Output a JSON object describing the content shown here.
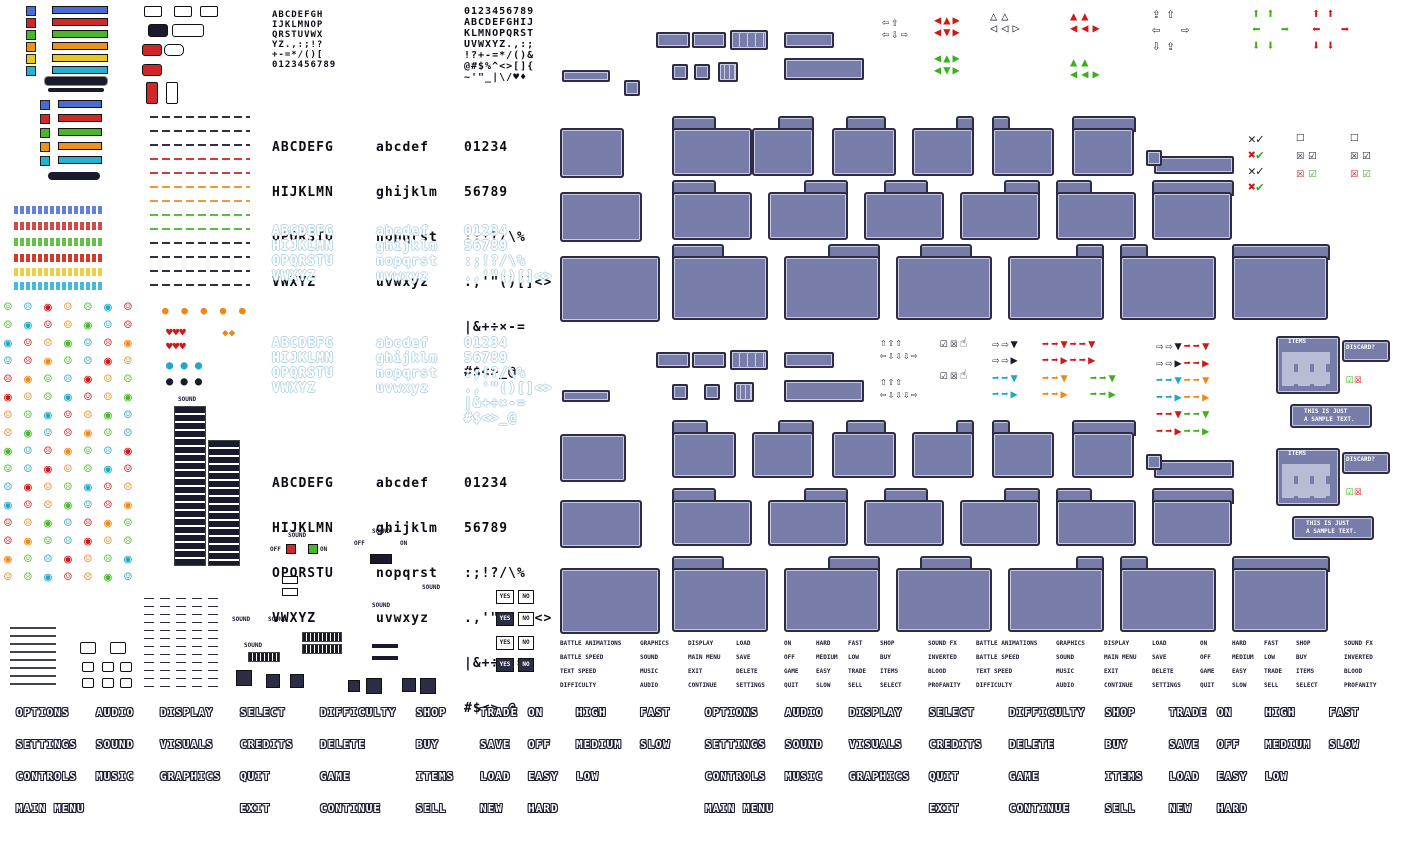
{
  "sheet": {
    "alphabet_upper_lines": [
      "ABCDEFG",
      "HIJKLMN",
      "OPQRSTU",
      "VWXYZ"
    ],
    "alphabet_lower_lines": [
      "abcdef",
      "ghijklm",
      "nopqrst",
      "uvwxyz"
    ],
    "digits_lines": [
      "01234",
      "56789",
      ":;!?/\\%",
      ".,'\"()[]<>",
      "|&+÷×-=",
      "#$<>_@"
    ],
    "alphabet_upper_lines_2": [
      "ABCDEFG",
      "HIJKLMN",
      "OPQRSTU",
      "VWXYZ"
    ],
    "alphabet_lower_lines_2": [
      "abcdef",
      "ghijklm",
      "nopqrst",
      "uvwxyz"
    ],
    "digits_lines_2": [
      "01234",
      "56789",
      ":;!?/\\%",
      ".,'\"()[]<>",
      "|&+÷×-=",
      "#$<>_@"
    ]
  },
  "widgets": {
    "sound_label": "SOUND",
    "off_label": "OFF",
    "on_label": "ON",
    "yes_label": "YES",
    "no_label": "NO",
    "items_label": "ITEMS",
    "discard_label": "DISCARD?",
    "sample_text_line1": "THIS IS JUST",
    "sample_text_line2": "A SAMPLE TEXT."
  },
  "tiny_words": [
    [
      "BATTLE ANIMATIONS",
      "GRAPHICS",
      "DISPLAY",
      "LOAD",
      "ON",
      "HARD",
      "FAST",
      "SHOP",
      "SOUND FX"
    ],
    [
      "BATTLE SPEED",
      "SOUND",
      "MAIN MENU",
      "SAVE",
      "OFF",
      "MEDIUM",
      "LOW",
      "BUY",
      "INVERTED"
    ],
    [
      "TEXT SPEED",
      "MUSIC",
      "EXIT",
      "DELETE",
      "GAME",
      "EASY",
      "TRADE",
      "ITEMS",
      "BLOOD"
    ],
    [
      "DIFFICULTY",
      "AUDIO",
      "CONTINUE",
      "SETTINGS",
      "QUIT",
      "SLOW",
      "SELL",
      "SELECT",
      "PROFANITY"
    ]
  ],
  "menu_words": {
    "col1": [
      "OPTIONS",
      "SETTINGS",
      "CONTROLS",
      "MAIN MENU"
    ],
    "col2": [
      "AUDIO",
      "SOUND",
      "MUSIC"
    ],
    "col3": [
      "DISPLAY",
      "VISUALS",
      "GRAPHICS"
    ],
    "col4": [
      "SELECT",
      "CREDITS",
      "QUIT",
      "EXIT"
    ],
    "col5": [
      "DIFFICULTY",
      "DELETE",
      "GAME",
      "CONTINUE"
    ],
    "col6": [
      "SHOP",
      "BUY",
      "ITEMS",
      "SELL"
    ],
    "col7": [
      "TRADE",
      "SAVE",
      "LOAD",
      "NEW"
    ],
    "col8": [
      "ON",
      "OFF",
      "EASY",
      "HARD"
    ],
    "col9": [
      "HIGH",
      "MEDIUM",
      "LOW"
    ],
    "col10": [
      "FAST",
      "SLOW"
    ]
  },
  "colors": {
    "panel_fill": "#787ca8",
    "panel_border": "#2c2c44",
    "red": "#d01818",
    "green": "#3cb01c",
    "orange": "#f08818",
    "yellow": "#e8c820",
    "cyan": "#20a8c8",
    "blue": "#2850c8"
  }
}
